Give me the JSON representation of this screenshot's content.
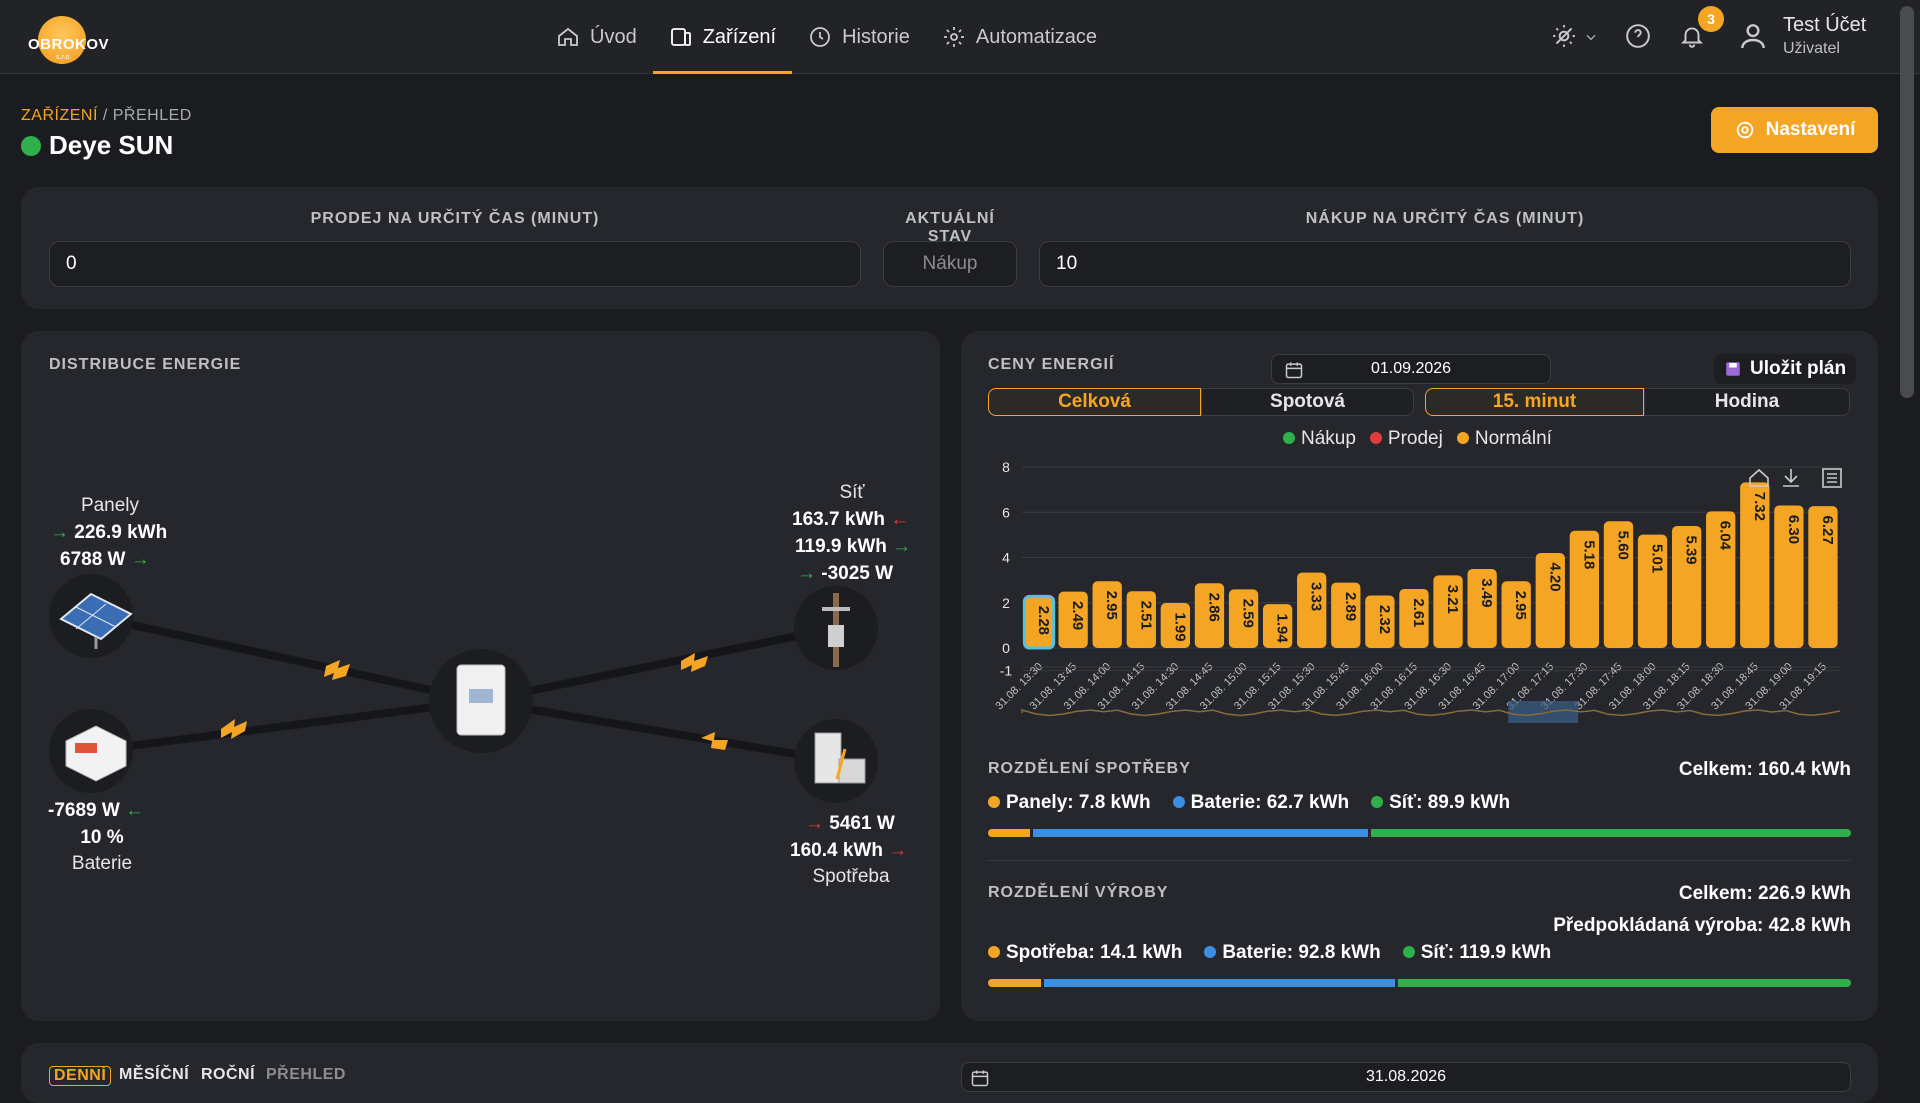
{
  "header": {
    "logo_text": "OBROKOV",
    "logo_sub": "s.r.o.",
    "nav": [
      {
        "label": "Úvod",
        "icon": "home-icon"
      },
      {
        "label": "Zařízení",
        "icon": "device-icon",
        "active": true
      },
      {
        "label": "Historie",
        "icon": "history-icon"
      },
      {
        "label": "Automatizace",
        "icon": "gear-icon"
      }
    ],
    "notifications": "3",
    "user": {
      "name": "Test Účet",
      "role": "Uživatel"
    }
  },
  "breadcrumb": {
    "section": "ZAŘÍZENÍ",
    "separator": " / ",
    "page": "PŘEHLED"
  },
  "device": {
    "name": "Deye SUN",
    "status_color": "#2fb04c"
  },
  "settings_button": "Nastavení",
  "controls": {
    "sell_label": "PRODEJ NA URČITÝ ČAS (MINUT)",
    "sell_value": "0",
    "state_label": "AKTUÁLNÍ STAV",
    "state_value": "Nákup",
    "buy_label": "NÁKUP NA URČITÝ ČAS (MINUT)",
    "buy_value": "10"
  },
  "distribution": {
    "title": "DISTRIBUCE ENERGIE",
    "panels": {
      "label": "Panely",
      "energy": "226.9 kWh",
      "power": "6788 W"
    },
    "grid": {
      "label": "Síť",
      "import": "163.7 kWh",
      "export": "119.9 kWh",
      "power": "-3025 W"
    },
    "battery": {
      "label": "Baterie",
      "power": "-7689 W",
      "soc": "10 %"
    },
    "consumption": {
      "label": "Spotřeba",
      "power": "5461 W",
      "energy": "160.4 kWh"
    }
  },
  "prices": {
    "title": "CENY ENERGIÍ",
    "date": "01.09.2026",
    "save_plan": "Uložit plán",
    "tabs_type": [
      "Celková",
      "Spotová"
    ],
    "tabs_interval": [
      "15. minut",
      "Hodina"
    ],
    "legend": [
      {
        "label": "Nákup",
        "color": "#2fb04c"
      },
      {
        "label": "Prodej",
        "color": "#e03c3c"
      },
      {
        "label": "Normální",
        "color": "#f5a524"
      }
    ]
  },
  "chart_data": {
    "type": "bar",
    "categories": [
      "31.08. 13:30",
      "31.08. 13:45",
      "31.08. 14:00",
      "31.08. 14:15",
      "31.08. 14:30",
      "31.08. 14:45",
      "31.08. 15:00",
      "31.08. 15:15",
      "31.08. 15:30",
      "31.08. 15:45",
      "31.08. 16:00",
      "31.08. 16:15",
      "31.08. 16:30",
      "31.08. 16:45",
      "31.08. 17:00",
      "31.08. 17:15",
      "31.08. 17:30",
      "31.08. 17:45",
      "31.08. 18:00",
      "31.08. 18:15",
      "31.08. 18:30",
      "31.08. 18:45",
      "31.08. 19:00",
      "31.08. 19:15"
    ],
    "values": [
      2.28,
      2.49,
      2.95,
      2.51,
      1.99,
      2.86,
      2.59,
      1.94,
      3.33,
      2.89,
      2.32,
      2.61,
      3.21,
      3.49,
      2.95,
      4.2,
      5.18,
      5.6,
      5.01,
      5.39,
      6.04,
      7.32,
      6.3,
      6.27
    ],
    "highlighted_index": 0,
    "ylim": [
      -1,
      8
    ],
    "yticks": [
      8,
      6,
      4,
      2,
      0,
      -1
    ],
    "bar_color": "#f5a524"
  },
  "consumption_split": {
    "title": "ROZDĚLENÍ SPOTŘEBY",
    "total": "Celkem: 160.4 kWh",
    "items": [
      {
        "label": "Panely: 7.8 kWh",
        "color": "#f5a524",
        "value": 7.8
      },
      {
        "label": "Baterie: 62.7 kWh",
        "color": "#3b8fe0",
        "value": 62.7
      },
      {
        "label": "Síť: 89.9 kWh",
        "color": "#2fb04c",
        "value": 89.9
      }
    ]
  },
  "production_split": {
    "title": "ROZDĚLENÍ VÝROBY",
    "total": "Celkem: 226.9 kWh",
    "forecast": "Předpokládaná výroba: 42.8 kWh",
    "items": [
      {
        "label": "Spotřeba: 14.1 kWh",
        "color": "#f5a524",
        "value": 14.1
      },
      {
        "label": "Baterie: 92.8 kWh",
        "color": "#3b8fe0",
        "value": 92.8
      },
      {
        "label": "Síť: 119.9 kWh",
        "color": "#2fb04c",
        "value": 119.9
      }
    ]
  },
  "bottom": {
    "tabs": [
      "DENNÍ",
      "MĚSÍČNÍ",
      "ROČNÍ",
      "PŘEHLED"
    ],
    "date": "31.08.2026"
  }
}
